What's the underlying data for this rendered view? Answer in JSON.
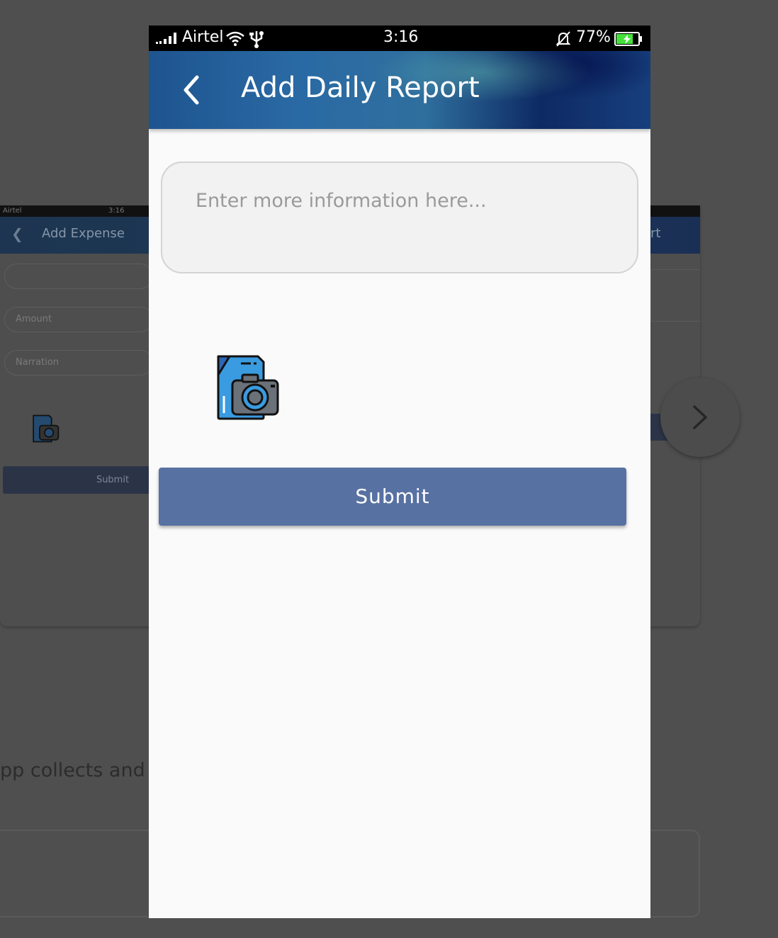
{
  "background_screen": {
    "status": {
      "carrier": "Airtel",
      "time": "3:16"
    },
    "title": "Add Expense",
    "right_title_fragment": "rt",
    "fields": [
      {
        "placeholder": ""
      },
      {
        "placeholder": "Amount"
      },
      {
        "placeholder": "Narration"
      }
    ],
    "submit_label": "Submit",
    "privacy_text": "pp collects and us"
  },
  "status_bar": {
    "carrier": "Airtel",
    "time": "3:16",
    "battery_percent": "77%",
    "battery_level": 0.77,
    "charging": true
  },
  "app_bar": {
    "title": "Add Daily Report",
    "back_icon": "chevron-left-icon"
  },
  "form": {
    "info_placeholder": "Enter more information here...",
    "info_value": "",
    "camera_icon": "camera-document-icon",
    "submit_label": "Submit"
  },
  "colors": {
    "primary_button": "#5871a3",
    "app_bar_blue": "#1e5490",
    "page_background": "#fafafa",
    "dim_overlay": "#4f4f4f",
    "battery_green": "#45e03c"
  }
}
